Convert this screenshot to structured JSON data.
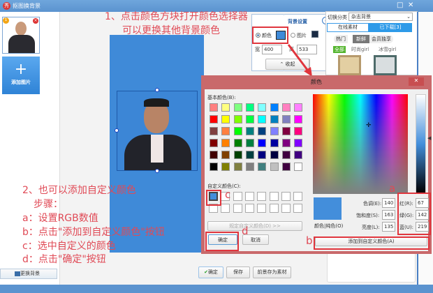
{
  "window": {
    "title": "抠图换背景",
    "minimize": "□",
    "close": "✕"
  },
  "sidebar": {
    "add_image_label": "添加图片",
    "add_icon": "+",
    "replace_bg_label": "更换背景",
    "thumb_badge": "1"
  },
  "annotations": {
    "step1_line1": "1、点击颜色方块打开颜色选择器",
    "step1_line2": "可以更换其他背景颜色",
    "step2_title": "2、也可以添加自定义颜色",
    "step2_sub": "步骤：",
    "step_a": "a：设置RGB数值",
    "step_b": "b：点击\"添加到自定义颜色\"按钮",
    "step_c": "c：选中自定义的颜色",
    "step_d": "d：点击\"确定\"按钮",
    "letter_a": "a",
    "letter_b": "b",
    "letter_c": "c",
    "letter_d": "d"
  },
  "bg_settings": {
    "title": "背景设置",
    "color_label": "颜色",
    "image_label": "图片",
    "width_label": "宽",
    "width_value": "400",
    "height_label": "高",
    "height_value": "533",
    "collapse_label": "收起",
    "selected_color": "#3f8ad8"
  },
  "materials": {
    "category_label": "切换分类",
    "category_value": "杂志背景",
    "tabs": [
      "在线素材",
      "已下载[3]"
    ],
    "subtabs": [
      "热门",
      "新鲜",
      "会员独享"
    ],
    "filters": [
      "全部",
      "时尚girl",
      "冰雪girl"
    ]
  },
  "bottom": {
    "confirm": "确定",
    "save": "保存",
    "save_foreground": "前景存为素材"
  },
  "color_dialog": {
    "title": "颜色",
    "close": "✕",
    "basic_label": "基本颜色(B):",
    "basic_colors": [
      "#ff8080",
      "#ffff80",
      "#80ff80",
      "#00ff80",
      "#80ffff",
      "#0080ff",
      "#ff80c0",
      "#ff80ff",
      "#ff0000",
      "#ffff00",
      "#80ff00",
      "#00ff40",
      "#00ffff",
      "#0080c0",
      "#8080c0",
      "#ff00ff",
      "#804040",
      "#ff8040",
      "#00ff00",
      "#008080",
      "#004080",
      "#8080ff",
      "#800040",
      "#ff0080",
      "#800000",
      "#ff8000",
      "#008000",
      "#008040",
      "#0000ff",
      "#0000a0",
      "#800080",
      "#8000ff",
      "#400000",
      "#804000",
      "#004000",
      "#004040",
      "#000080",
      "#000040",
      "#400040",
      "#400080",
      "#000000",
      "#808000",
      "#808040",
      "#808080",
      "#408080",
      "#c0c0c0",
      "#400040",
      "#ffffff"
    ],
    "custom_label": "自定义颜色(C):",
    "custom_first": "#438edb",
    "define_custom": "规定自定义颜色(D) >>",
    "ok": "确定",
    "cancel": "取消",
    "preview_label": "颜色|纯色(O)",
    "hue_label": "色调(E):",
    "hue": "140",
    "sat_label": "饱和度(S):",
    "sat": "163",
    "lum_label": "亮度(L):",
    "lum": "135",
    "red_label": "红(R):",
    "red": "67",
    "green_label": "绿(G):",
    "green": "142",
    "blue_label": "蓝(U):",
    "blue": "219",
    "add_custom": "添加到自定义颜色(A)"
  }
}
